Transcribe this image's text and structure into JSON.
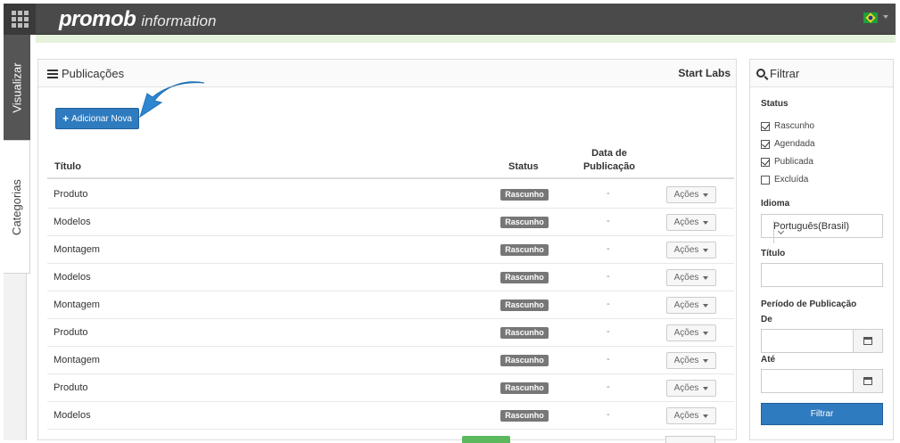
{
  "header": {
    "logo_main": "promob",
    "logo_sub": "information"
  },
  "side_tabs": {
    "visualizar": "Visualizar",
    "categorias": "Categorias"
  },
  "main": {
    "title": "Publicações",
    "company": "Start Labs",
    "add_button": "Adicionar Nova",
    "columns": {
      "title": "Título",
      "status": "Status",
      "date_line1": "Data de",
      "date_line2": "Publicação"
    },
    "rows": [
      {
        "title": "Produto",
        "status": "Rascunho",
        "date": "-",
        "actions": "Ações"
      },
      {
        "title": "Modelos",
        "status": "Rascunho",
        "date": "-",
        "actions": "Ações"
      },
      {
        "title": "Montagem",
        "status": "Rascunho",
        "date": "-",
        "actions": "Ações"
      },
      {
        "title": "Modelos",
        "status": "Rascunho",
        "date": "-",
        "actions": "Ações"
      },
      {
        "title": "Montagem",
        "status": "Rascunho",
        "date": "-",
        "actions": "Ações"
      },
      {
        "title": "Produto",
        "status": "Rascunho",
        "date": "-",
        "actions": "Ações"
      },
      {
        "title": "Montagem",
        "status": "Rascunho",
        "date": "-",
        "actions": "Ações"
      },
      {
        "title": "Produto",
        "status": "Rascunho",
        "date": "-",
        "actions": "Ações"
      },
      {
        "title": "Modelos",
        "status": "Rascunho",
        "date": "-",
        "actions": "Ações"
      }
    ]
  },
  "filter": {
    "title": "Filtrar",
    "status_label": "Status",
    "status_options": [
      {
        "label": "Rascunho",
        "checked": true
      },
      {
        "label": "Agendada",
        "checked": true
      },
      {
        "label": "Publicada",
        "checked": true
      },
      {
        "label": "Excluída",
        "checked": false
      }
    ],
    "language_label": "Idioma",
    "language_value": "Português(Brasil)",
    "title_label": "Título",
    "title_value": "",
    "period_label": "Período de Publicação",
    "from_label": "De",
    "from_value": "",
    "to_label": "Até",
    "to_value": "",
    "filter_button": "Filtrar"
  },
  "colors": {
    "topbar": "#4a4a4a",
    "primary": "#2f7bbf",
    "badge_draft": "#777777",
    "badge_published": "#5cb85c",
    "arrow": "#2f86d1"
  },
  "icons": {
    "apps": "grid-icon",
    "flag": "brazil-flag-icon",
    "list": "list-icon",
    "add": "plus-icon",
    "search": "search-icon",
    "calendar": "calendar-icon"
  }
}
